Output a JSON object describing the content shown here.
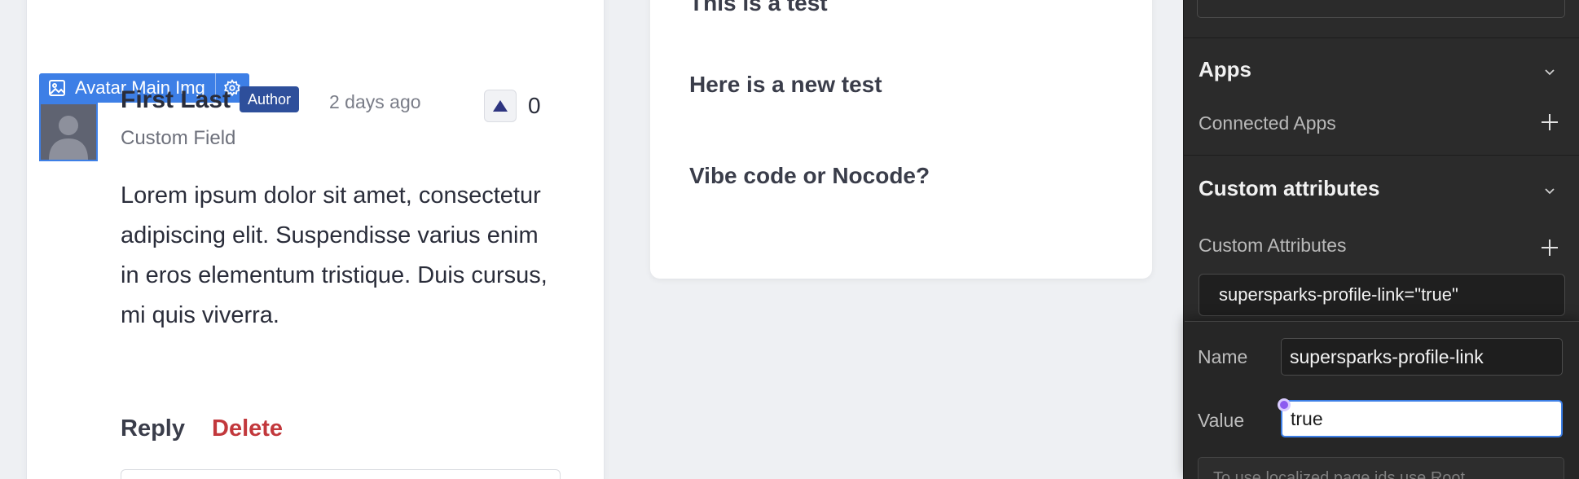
{
  "canvas": {
    "selection_label": "Avatar Main Img",
    "comment": {
      "author": "First Last",
      "badge": "Author",
      "time_ago": "2 days ago",
      "custom_field": "Custom Field",
      "vote_count": "0",
      "body": "Lorem ipsum dolor sit amet, consectetur adipiscing elit. Suspendisse varius enim in eros elementum tristique. Duis cursus, mi quis viverra.",
      "reply_label": "Reply",
      "delete_label": "Delete"
    },
    "posts": [
      "This is a test",
      "Here is a new test",
      "Vibe code or Nocode?"
    ]
  },
  "panel": {
    "apps": {
      "title": "Apps",
      "connected_label": "Connected Apps"
    },
    "custom_attributes": {
      "title": "Custom attributes",
      "row_label": "Custom Attributes",
      "chip": "supersparks-profile-link=\"true\""
    },
    "popup": {
      "name_label": "Name",
      "name_value": "supersparks-profile-link",
      "value_label": "Value",
      "value_value": "true",
      "hint": "To use localized page ids use Root"
    }
  },
  "colors": {
    "selection_blue": "#3d7fe6",
    "author_badge": "#2e4f9b",
    "delete_red": "#c2383c",
    "focus_dot": "#8c5bf0"
  },
  "icons": [
    "image-icon",
    "gear-icon",
    "upvote-arrow-icon",
    "chevron-down-icon",
    "plus-icon"
  ]
}
